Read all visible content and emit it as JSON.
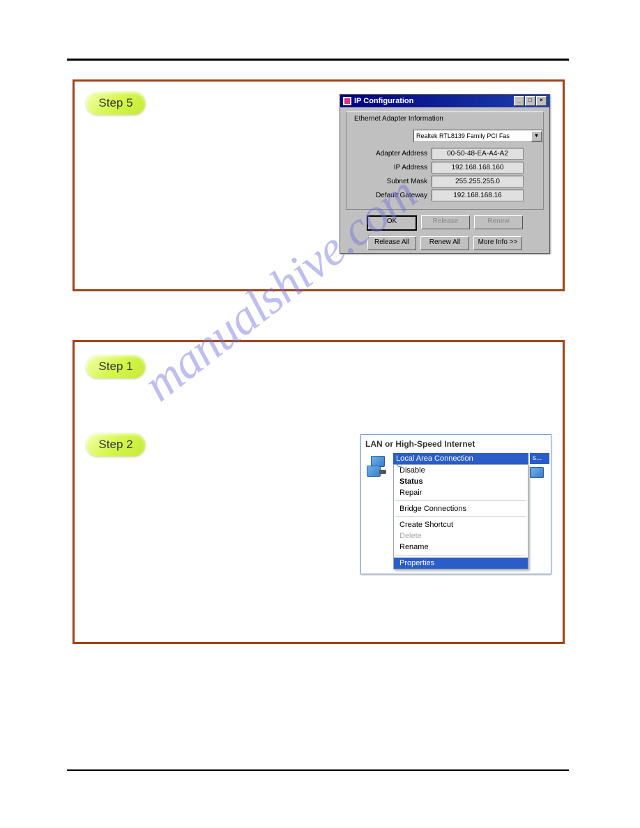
{
  "steps": {
    "step5": "Step 5",
    "step1": "Step 1",
    "step2": "Step 2"
  },
  "ipconfig": {
    "title": "IP Configuration",
    "group": "Ethernet Adapter Information",
    "adapter": "Realtek RTL8139 Family PCI Fas",
    "fields": {
      "adapter_address_label": "Adapter Address",
      "adapter_address_value": "00-50-48-EA-A4-A2",
      "ip_address_label": "IP Address",
      "ip_address_value": "192.168.168.160",
      "subnet_label": "Subnet Mask",
      "subnet_value": "255.255.255.0",
      "gateway_label": "Default Gateway",
      "gateway_value": "192.168.168.16"
    },
    "buttons": {
      "ok": "OK",
      "release": "Release",
      "renew": "Renew",
      "release_all": "Release All",
      "renew_all": "Renew All",
      "more_info": "More Info >>"
    }
  },
  "lan": {
    "title": "LAN or High-Speed Internet",
    "selected": "Local Area Connection",
    "menu": {
      "disable": "Disable",
      "status": "Status",
      "repair": "Repair",
      "bridge": "Bridge Connections",
      "shortcut": "Create Shortcut",
      "delete": "Delete",
      "rename": "Rename",
      "properties": "Properties"
    },
    "right_trunc": "s..."
  },
  "watermark": "manualshive.com"
}
